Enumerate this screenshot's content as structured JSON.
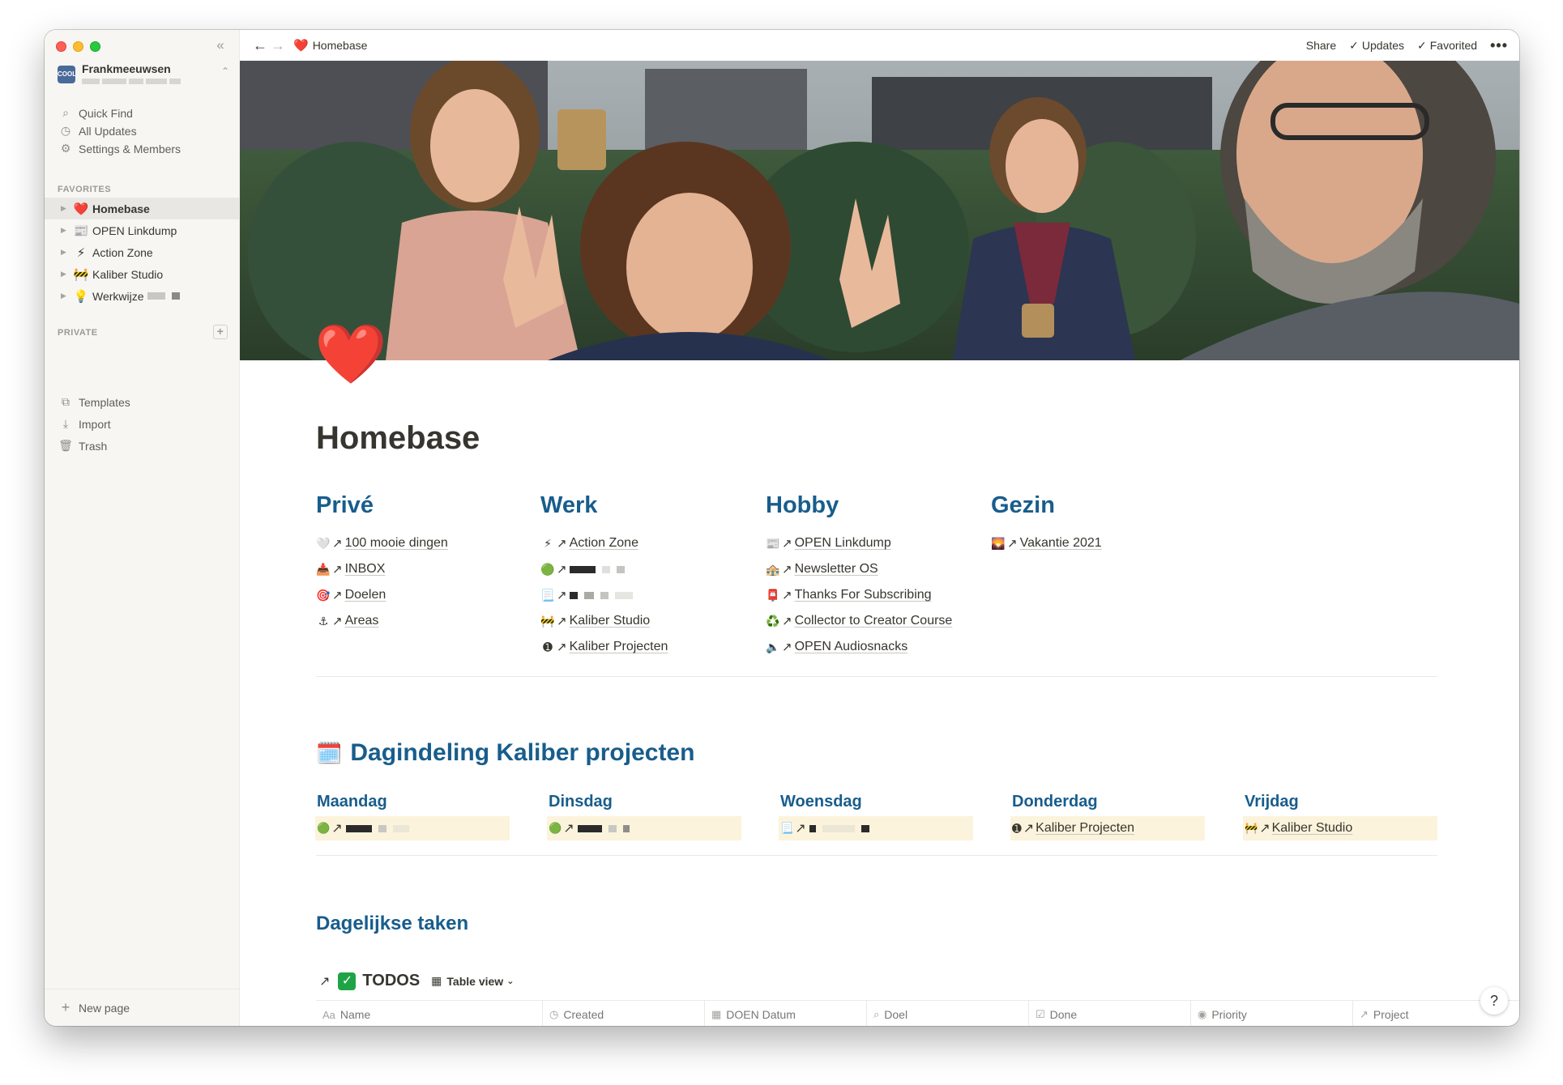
{
  "window": {
    "sidebar": {
      "workspace_name": "Frankmeeuwsen",
      "workspace_avatar_text": "COOL",
      "nav": [
        {
          "label": "Quick Find",
          "icon": "search-icon"
        },
        {
          "label": "All Updates",
          "icon": "clock-icon"
        },
        {
          "label": "Settings & Members",
          "icon": "gear-icon"
        }
      ],
      "favorites_label": "FAVORITES",
      "favorites": [
        {
          "label": "Homebase",
          "emoji": "❤️"
        },
        {
          "label": "OPEN Linkdump",
          "emoji": "📰"
        },
        {
          "label": "Action Zone",
          "emoji": "⚡"
        },
        {
          "label": "Kaliber Studio",
          "emoji": "🚧"
        },
        {
          "label": "Werkwijze",
          "emoji": "💡"
        }
      ],
      "private_label": "PRIVATE",
      "tools": [
        {
          "label": "Templates",
          "icon": "templates-icon"
        },
        {
          "label": "Import",
          "icon": "import-icon"
        },
        {
          "label": "Trash",
          "icon": "trash-icon"
        }
      ],
      "new_page": "New page"
    },
    "topbar": {
      "breadcrumb": "Homebase",
      "breadcrumb_emoji": "❤️",
      "share": "Share",
      "updates": "Updates",
      "favorited": "Favorited",
      "more": "•••"
    },
    "page": {
      "icon": "❤️",
      "title": "Homebase",
      "columns": [
        {
          "heading": "Privé",
          "links": [
            {
              "emoji": "🤍",
              "text": "100 mooie dingen"
            },
            {
              "emoji": "📥",
              "text": "INBOX"
            },
            {
              "emoji": "🎯",
              "text": "Doelen"
            },
            {
              "emoji": "⚓",
              "text": "Areas"
            }
          ]
        },
        {
          "heading": "Werk",
          "links": [
            {
              "emoji": "⚡",
              "text": "Action Zone"
            },
            {
              "emoji": "🟢",
              "text": ""
            },
            {
              "emoji": "📃",
              "text": ""
            },
            {
              "emoji": "🚧",
              "text": "Kaliber Studio"
            },
            {
              "emoji": "➊",
              "text": "Kaliber Projecten"
            }
          ]
        },
        {
          "heading": "Hobby",
          "links": [
            {
              "emoji": "📰",
              "text": "OPEN Linkdump"
            },
            {
              "emoji": "🏤",
              "text": "Newsletter OS"
            },
            {
              "emoji": "📮",
              "text": "Thanks For Subscribing"
            },
            {
              "emoji": "♻️",
              "text": "Collector to Creator Course"
            },
            {
              "emoji": "🔈",
              "text": "OPEN Audiosnacks"
            }
          ]
        },
        {
          "heading": "Gezin",
          "links": [
            {
              "emoji": "🌄",
              "text": "Vakantie 2021"
            }
          ]
        }
      ],
      "schedule": {
        "emoji": "🗓️",
        "heading": "Dagindeling Kaliber projecten",
        "days": [
          {
            "day": "Maandag",
            "emoji": "🟢",
            "text": ""
          },
          {
            "day": "Dinsdag",
            "emoji": "🟢",
            "text": ""
          },
          {
            "day": "Woensdag",
            "emoji": "📃",
            "text": ""
          },
          {
            "day": "Donderdag",
            "emoji": "➊",
            "text": "Kaliber Projecten"
          },
          {
            "day": "Vrijdag",
            "emoji": "🚧",
            "text": "Kaliber Studio"
          }
        ]
      },
      "daily_heading": "Dagelijkse taken",
      "todos": {
        "arrow": "↗",
        "check": "✓",
        "title": "TODOS",
        "view_label": "Table view",
        "columns": [
          {
            "label": "Name",
            "icon": "Aa"
          },
          {
            "label": "Created",
            "icon": "◷"
          },
          {
            "label": "DOEN Datum",
            "icon": "▦"
          },
          {
            "label": "Doel",
            "icon": "⌕"
          },
          {
            "label": "Done",
            "icon": "☑"
          },
          {
            "label": "Priority",
            "icon": "◉"
          },
          {
            "label": "Project",
            "icon": "↗"
          }
        ]
      },
      "help": "?"
    }
  }
}
